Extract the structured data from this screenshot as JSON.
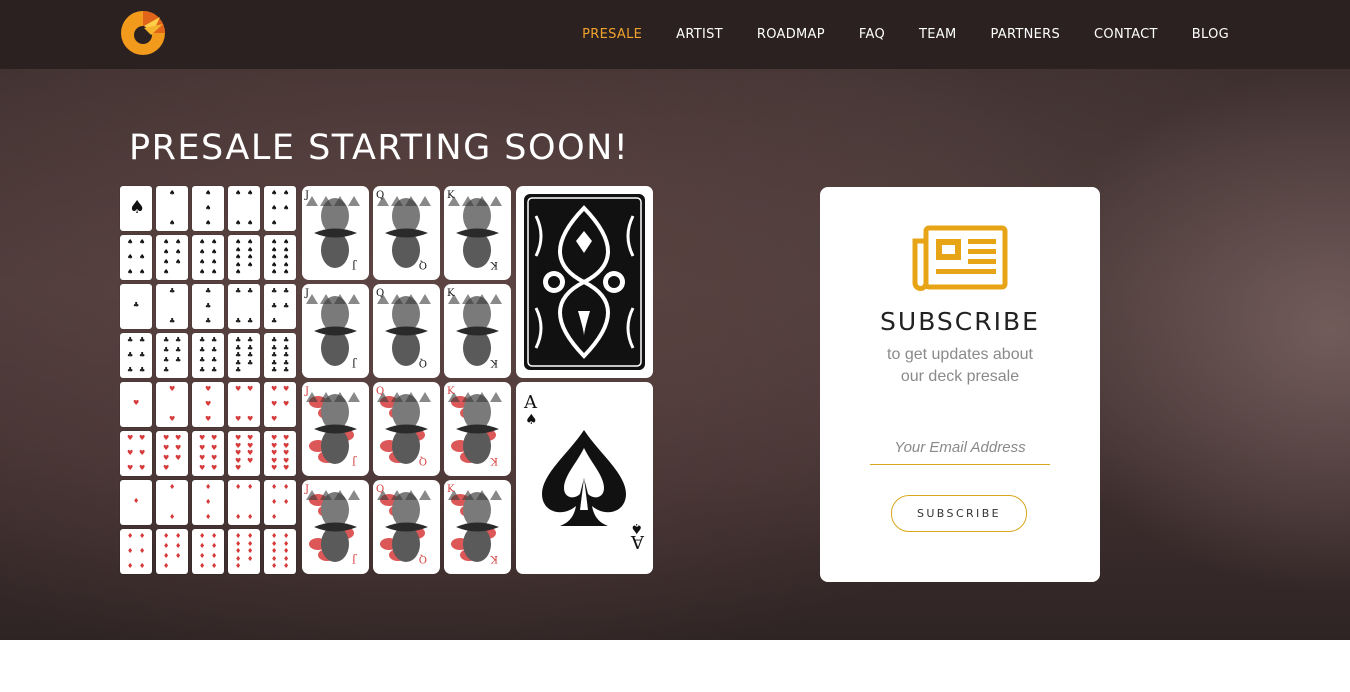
{
  "nav": {
    "logo_icon": "c-logo-icon",
    "items": [
      {
        "label": "PRESALE",
        "active": true
      },
      {
        "label": "ARTIST"
      },
      {
        "label": "ROADMAP"
      },
      {
        "label": "FAQ"
      },
      {
        "label": "TEAM"
      },
      {
        "label": "PARTNERS"
      },
      {
        "label": "CONTACT"
      },
      {
        "label": "BLOG"
      }
    ]
  },
  "hero": {
    "headline": "PRESALE STARTING SOON!",
    "cards": {
      "suits": [
        "♠",
        "♣",
        "♥",
        "♦"
      ],
      "face_ranks": [
        "J",
        "Q",
        "K"
      ],
      "ace_rank": "A",
      "ace_suit": "♠",
      "colors": {
        "black": "#111111",
        "red": "#d63a3a"
      }
    }
  },
  "subscribe": {
    "icon": "newspaper-icon",
    "title": "SUBSCRIBE",
    "text_line1": "to get updates about",
    "text_line2": "our deck presale",
    "email_placeholder": "Your Email Address",
    "button_label": "SUBSCRIBE",
    "accent": "#e8a417"
  }
}
